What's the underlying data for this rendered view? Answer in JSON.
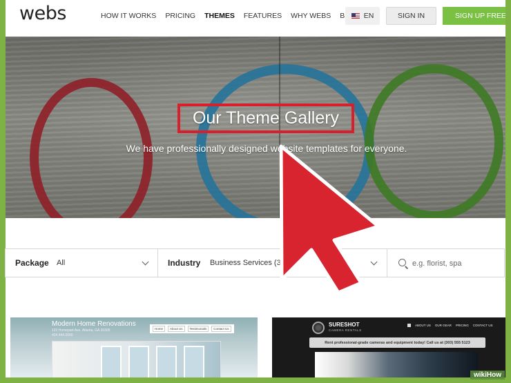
{
  "header": {
    "logo": "webs",
    "nav": [
      "HOW IT WORKS",
      "PRICING",
      "THEMES",
      "FEATURES",
      "WHY WEBS",
      "BLOG"
    ],
    "active_nav": "THEMES",
    "language": "EN",
    "sign_in": "SIGN IN",
    "sign_up": "SIGN UP FREE"
  },
  "hero": {
    "title": "Our Theme Gallery",
    "subtitle": "We have professionally designed website templates for everyone."
  },
  "filters": {
    "package_label": "Package",
    "package_value": "All",
    "industry_label": "Industry",
    "industry_value": "Business Services (3",
    "search_placeholder": "e.g. florist, spa"
  },
  "cards": {
    "left": {
      "title": "Modern Home Renovations",
      "address_line1": "123 Homepart Ave, Atlanta, GA 30305",
      "address_line2": "404.444.0000",
      "nav": [
        "Home",
        "About Us",
        "Testimonials",
        "Contact Us"
      ]
    },
    "right": {
      "brand": "SURESHOT",
      "tagline": "CAMERA RENTALS",
      "nav": [
        "ABOUT US",
        "OUR GEAR",
        "PRICING",
        "CONTACT US"
      ],
      "banner": "Rent professional-grade cameras and equipment today! Call us at (303) 555 5123"
    }
  },
  "watermark": "wikiHow",
  "colors": {
    "accent_green": "#7ac043",
    "highlight_red": "#d81f2c",
    "arrow_red": "#d8242f"
  },
  "icons": [
    "us-flag-icon",
    "chevron-down-icon",
    "search-icon",
    "pointer-arrow-icon"
  ]
}
